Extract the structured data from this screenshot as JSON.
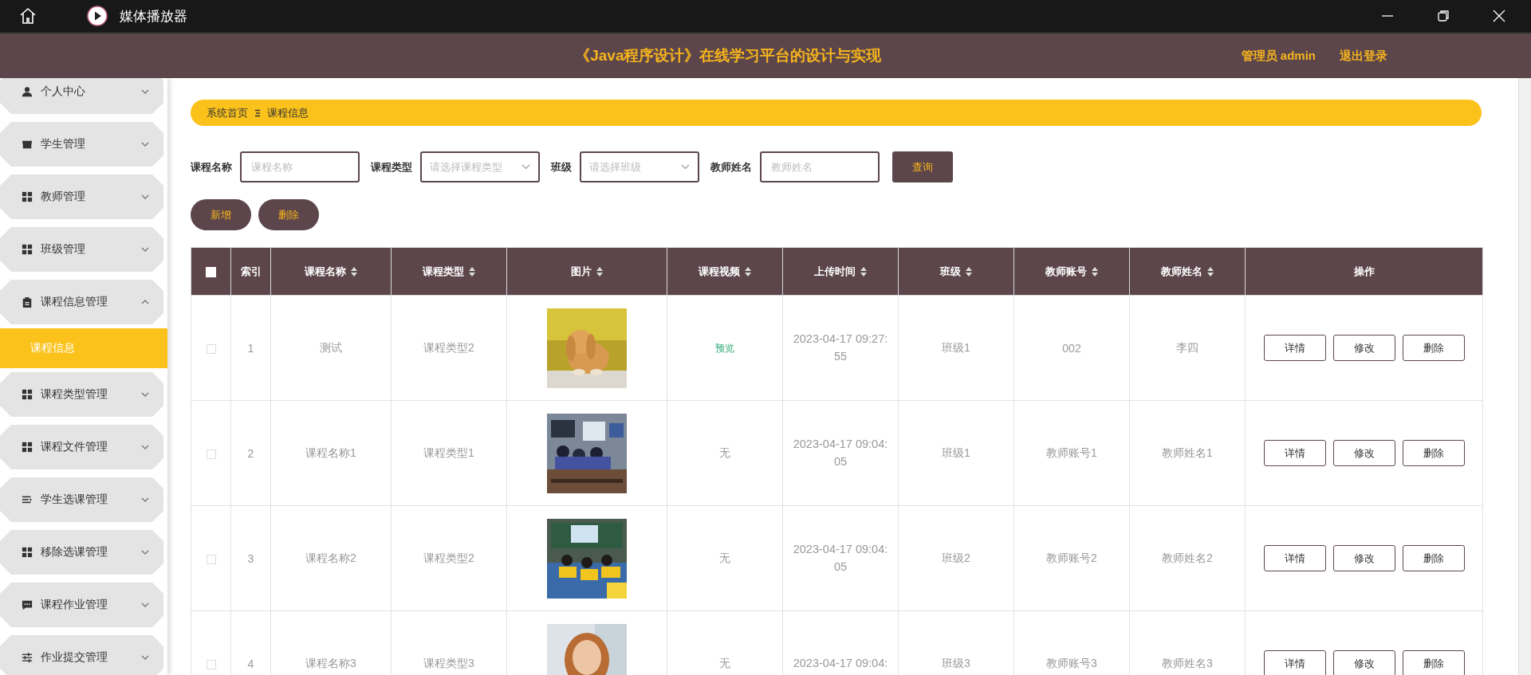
{
  "window": {
    "title": "媒体播放器"
  },
  "header": {
    "title": "《Java程序设计》在线学习平台的设计与实现",
    "user": "管理员 admin",
    "logout": "退出登录"
  },
  "sidebar": {
    "items": [
      {
        "label": "个人中心",
        "kind": "person",
        "expanded": false
      },
      {
        "label": "学生管理",
        "kind": "shop",
        "expanded": false
      },
      {
        "label": "教师管理",
        "kind": "grid",
        "expanded": false
      },
      {
        "label": "班级管理",
        "kind": "grid",
        "expanded": false
      },
      {
        "label": "课程信息管理",
        "kind": "doc",
        "expanded": true,
        "children": [
          {
            "label": "课程信息",
            "selected": true
          }
        ]
      },
      {
        "label": "课程类型管理",
        "kind": "grid",
        "expanded": false
      },
      {
        "label": "课程文件管理",
        "kind": "grid",
        "expanded": false
      },
      {
        "label": "学生选课管理",
        "kind": "list",
        "expanded": false
      },
      {
        "label": "移除选课管理",
        "kind": "grid",
        "expanded": false
      },
      {
        "label": "课程作业管理",
        "kind": "chat",
        "expanded": false
      },
      {
        "label": "作业提交管理",
        "kind": "sliders",
        "expanded": false
      }
    ]
  },
  "breadcrumb": [
    "系统首页",
    "课程信息"
  ],
  "filters": [
    {
      "label": "课程名称",
      "kind": "input",
      "placeholder": "课程名称"
    },
    {
      "label": "课程类型",
      "kind": "select",
      "placeholder": "请选择课程类型"
    },
    {
      "label": "班级",
      "kind": "select",
      "placeholder": "请选择班级"
    },
    {
      "label": "教师姓名",
      "kind": "input",
      "placeholder": "教师姓名"
    }
  ],
  "search_button": "查询",
  "toolbar": [
    "新增",
    "删除"
  ],
  "table": {
    "select_all": {
      "checked": false
    },
    "columns": [
      {
        "label": "索引",
        "sortable": false
      },
      {
        "label": "课程名称",
        "sortable": true
      },
      {
        "label": "课程类型",
        "sortable": true
      },
      {
        "label": "图片",
        "sortable": true
      },
      {
        "label": "课程视频",
        "sortable": true
      },
      {
        "label": "上传时间",
        "sortable": true
      },
      {
        "label": "班级",
        "sortable": true
      },
      {
        "label": "教师账号",
        "sortable": true
      },
      {
        "label": "教师姓名",
        "sortable": true
      },
      {
        "label": "操作",
        "sortable": false
      }
    ],
    "rows": [
      {
        "checked": false,
        "index": "1",
        "name": "测试",
        "type": "课程类型2",
        "image": {
          "kind": "picture"
        },
        "video": {
          "text": "预览",
          "kind": "link"
        },
        "time": "2023-04-17 09:27:55",
        "class": "班级1",
        "teacher_account": "002",
        "teacher_name": "李四",
        "actions": [
          "详情",
          "修改",
          "删除"
        ]
      },
      {
        "checked": false,
        "index": "2",
        "name": "课程名称1",
        "type": "课程类型1",
        "image": {
          "kind": "picture"
        },
        "video": {
          "text": "无",
          "kind": "text"
        },
        "time": "2023-04-17 09:04:05",
        "class": "班级1",
        "teacher_account": "教师账号1",
        "teacher_name": "教师姓名1",
        "actions": [
          "详情",
          "修改",
          "删除"
        ]
      },
      {
        "checked": false,
        "index": "3",
        "name": "课程名称2",
        "type": "课程类型2",
        "image": {
          "kind": "picture"
        },
        "video": {
          "text": "无",
          "kind": "text"
        },
        "time": "2023-04-17 09:04:05",
        "class": "班级2",
        "teacher_account": "教师账号2",
        "teacher_name": "教师姓名2",
        "actions": [
          "详情",
          "修改",
          "删除"
        ]
      },
      {
        "checked": false,
        "index": "4",
        "name": "课程名称3",
        "type": "课程类型3",
        "image": {
          "kind": "picture"
        },
        "video": {
          "text": "无",
          "kind": "text"
        },
        "time": "2023-04-17 09:04:",
        "class": "班级3",
        "teacher_account": "教师账号3",
        "teacher_name": "教师姓名3",
        "actions": [
          "详情",
          "修改",
          "删除"
        ]
      }
    ]
  }
}
